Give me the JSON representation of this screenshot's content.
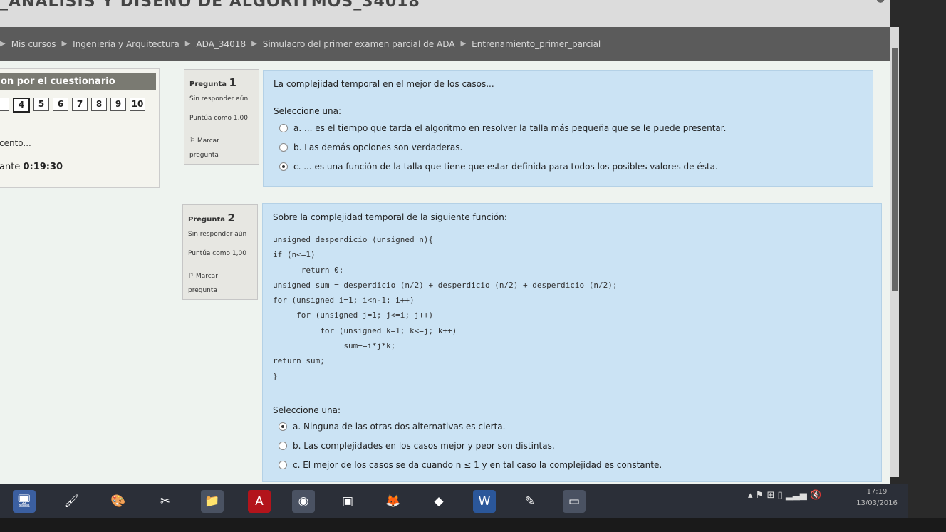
{
  "window": {
    "title": "_ANÁLISIS Y DISEÑO DE ALGORITMOS_34018"
  },
  "breadcrumb": {
    "items": [
      "Mis cursos",
      "Ingeniería y Arquitectura",
      "ADA_34018",
      "Simulacro del primer examen parcial de ADA",
      "Entrenamiento_primer_parcial"
    ]
  },
  "quiz_nav": {
    "heading": "on por el cuestionario",
    "buttons": [
      "4",
      "5",
      "6",
      "7",
      "8",
      "9",
      "10"
    ],
    "current": "4",
    "status": "cento...",
    "timer_label": "ante",
    "timer_value": "0:19:30"
  },
  "q1": {
    "label": "Pregunta",
    "number": "1",
    "state": "Sin responder aún",
    "points": "Puntúa como 1,00",
    "flag_line1": "Marcar",
    "flag_line2": "pregunta",
    "text": "La complejidad temporal en el mejor de los casos...",
    "prompt": "Seleccione una:",
    "options": [
      "a. ... es el tiempo que tarda el algoritmo en resolver la talla más pequeña que se le puede presentar.",
      "b. Las demás opciones son verdaderas.",
      "c. ... es una función de la talla que tiene que estar definida para todos los posibles valores de ésta."
    ],
    "selected": 2
  },
  "q2": {
    "label": "Pregunta",
    "number": "2",
    "state": "Sin responder aún",
    "points": "Puntúa como 1,00",
    "flag_line1": "Marcar",
    "flag_line2": "pregunta",
    "text": "Sobre la complejidad temporal de la siguiente función:",
    "code": [
      "unsigned desperdicio (unsigned n){",
      "if (n<=1)",
      "      return 0;",
      "unsigned sum = desperdicio (n/2) + desperdicio (n/2) + desperdicio (n/2);",
      "for (unsigned i=1; i<n-1; i++)",
      "     for (unsigned j=1; j<=i; j++)",
      "          for (unsigned k=1; k<=j; k++)",
      "               sum+=i*j*k;",
      "return sum;",
      "}"
    ],
    "prompt": "Seleccione una:",
    "options": [
      "a. Ninguna de las otras dos alternativas es cierta.",
      "b. Las complejidades en los casos mejor y peor son distintas.",
      "c. El mejor de los casos se da cuando n ≤ 1 y en tal caso la complejidad es constante."
    ],
    "selected": 0
  },
  "taskbar": {
    "time": "17:19",
    "date": "13/03/2016"
  }
}
